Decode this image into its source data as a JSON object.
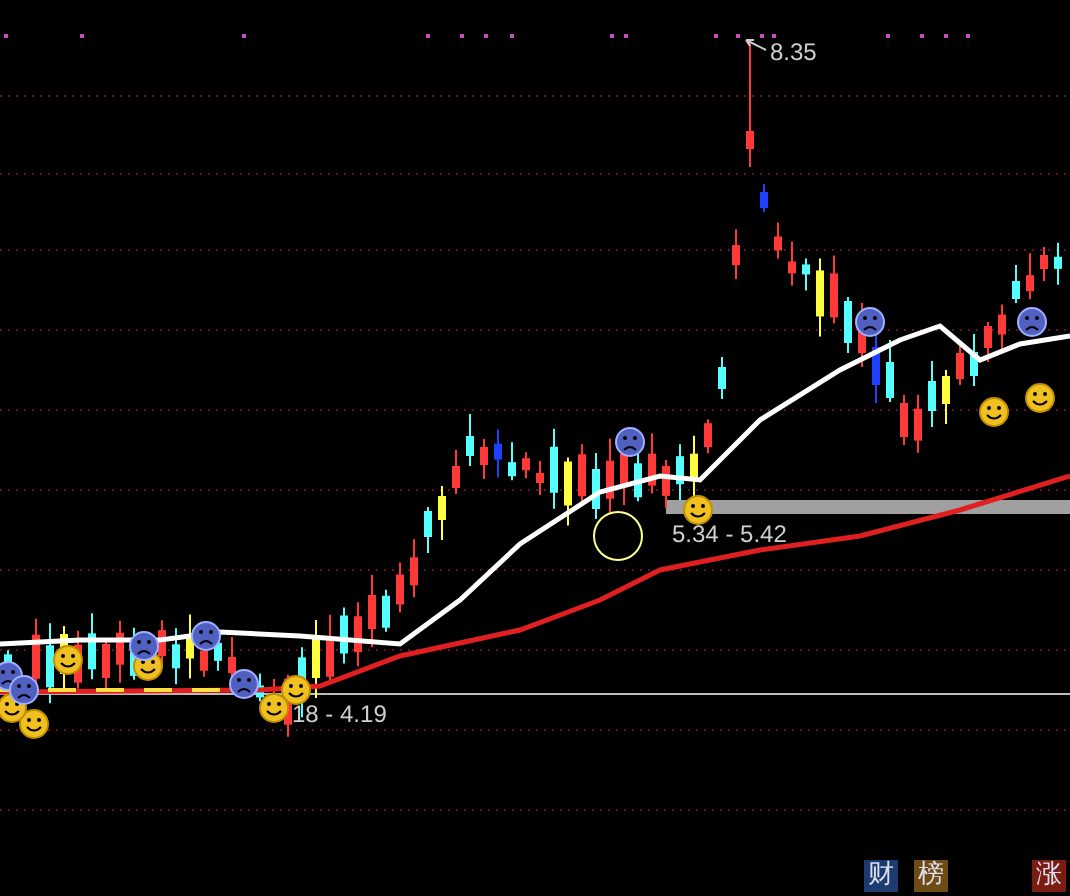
{
  "chart": {
    "annotations": [
      {
        "text": "8.35"
      },
      {
        "text": "5.34 - 5.42"
      },
      {
        "text": "18 - 4.19"
      }
    ]
  },
  "tags": [
    {
      "label": "财",
      "color": "#1c3c70"
    },
    {
      "label": "榜",
      "color": "#6e4a14"
    },
    {
      "label": "涨",
      "color": "#7a1c12"
    }
  ]
}
